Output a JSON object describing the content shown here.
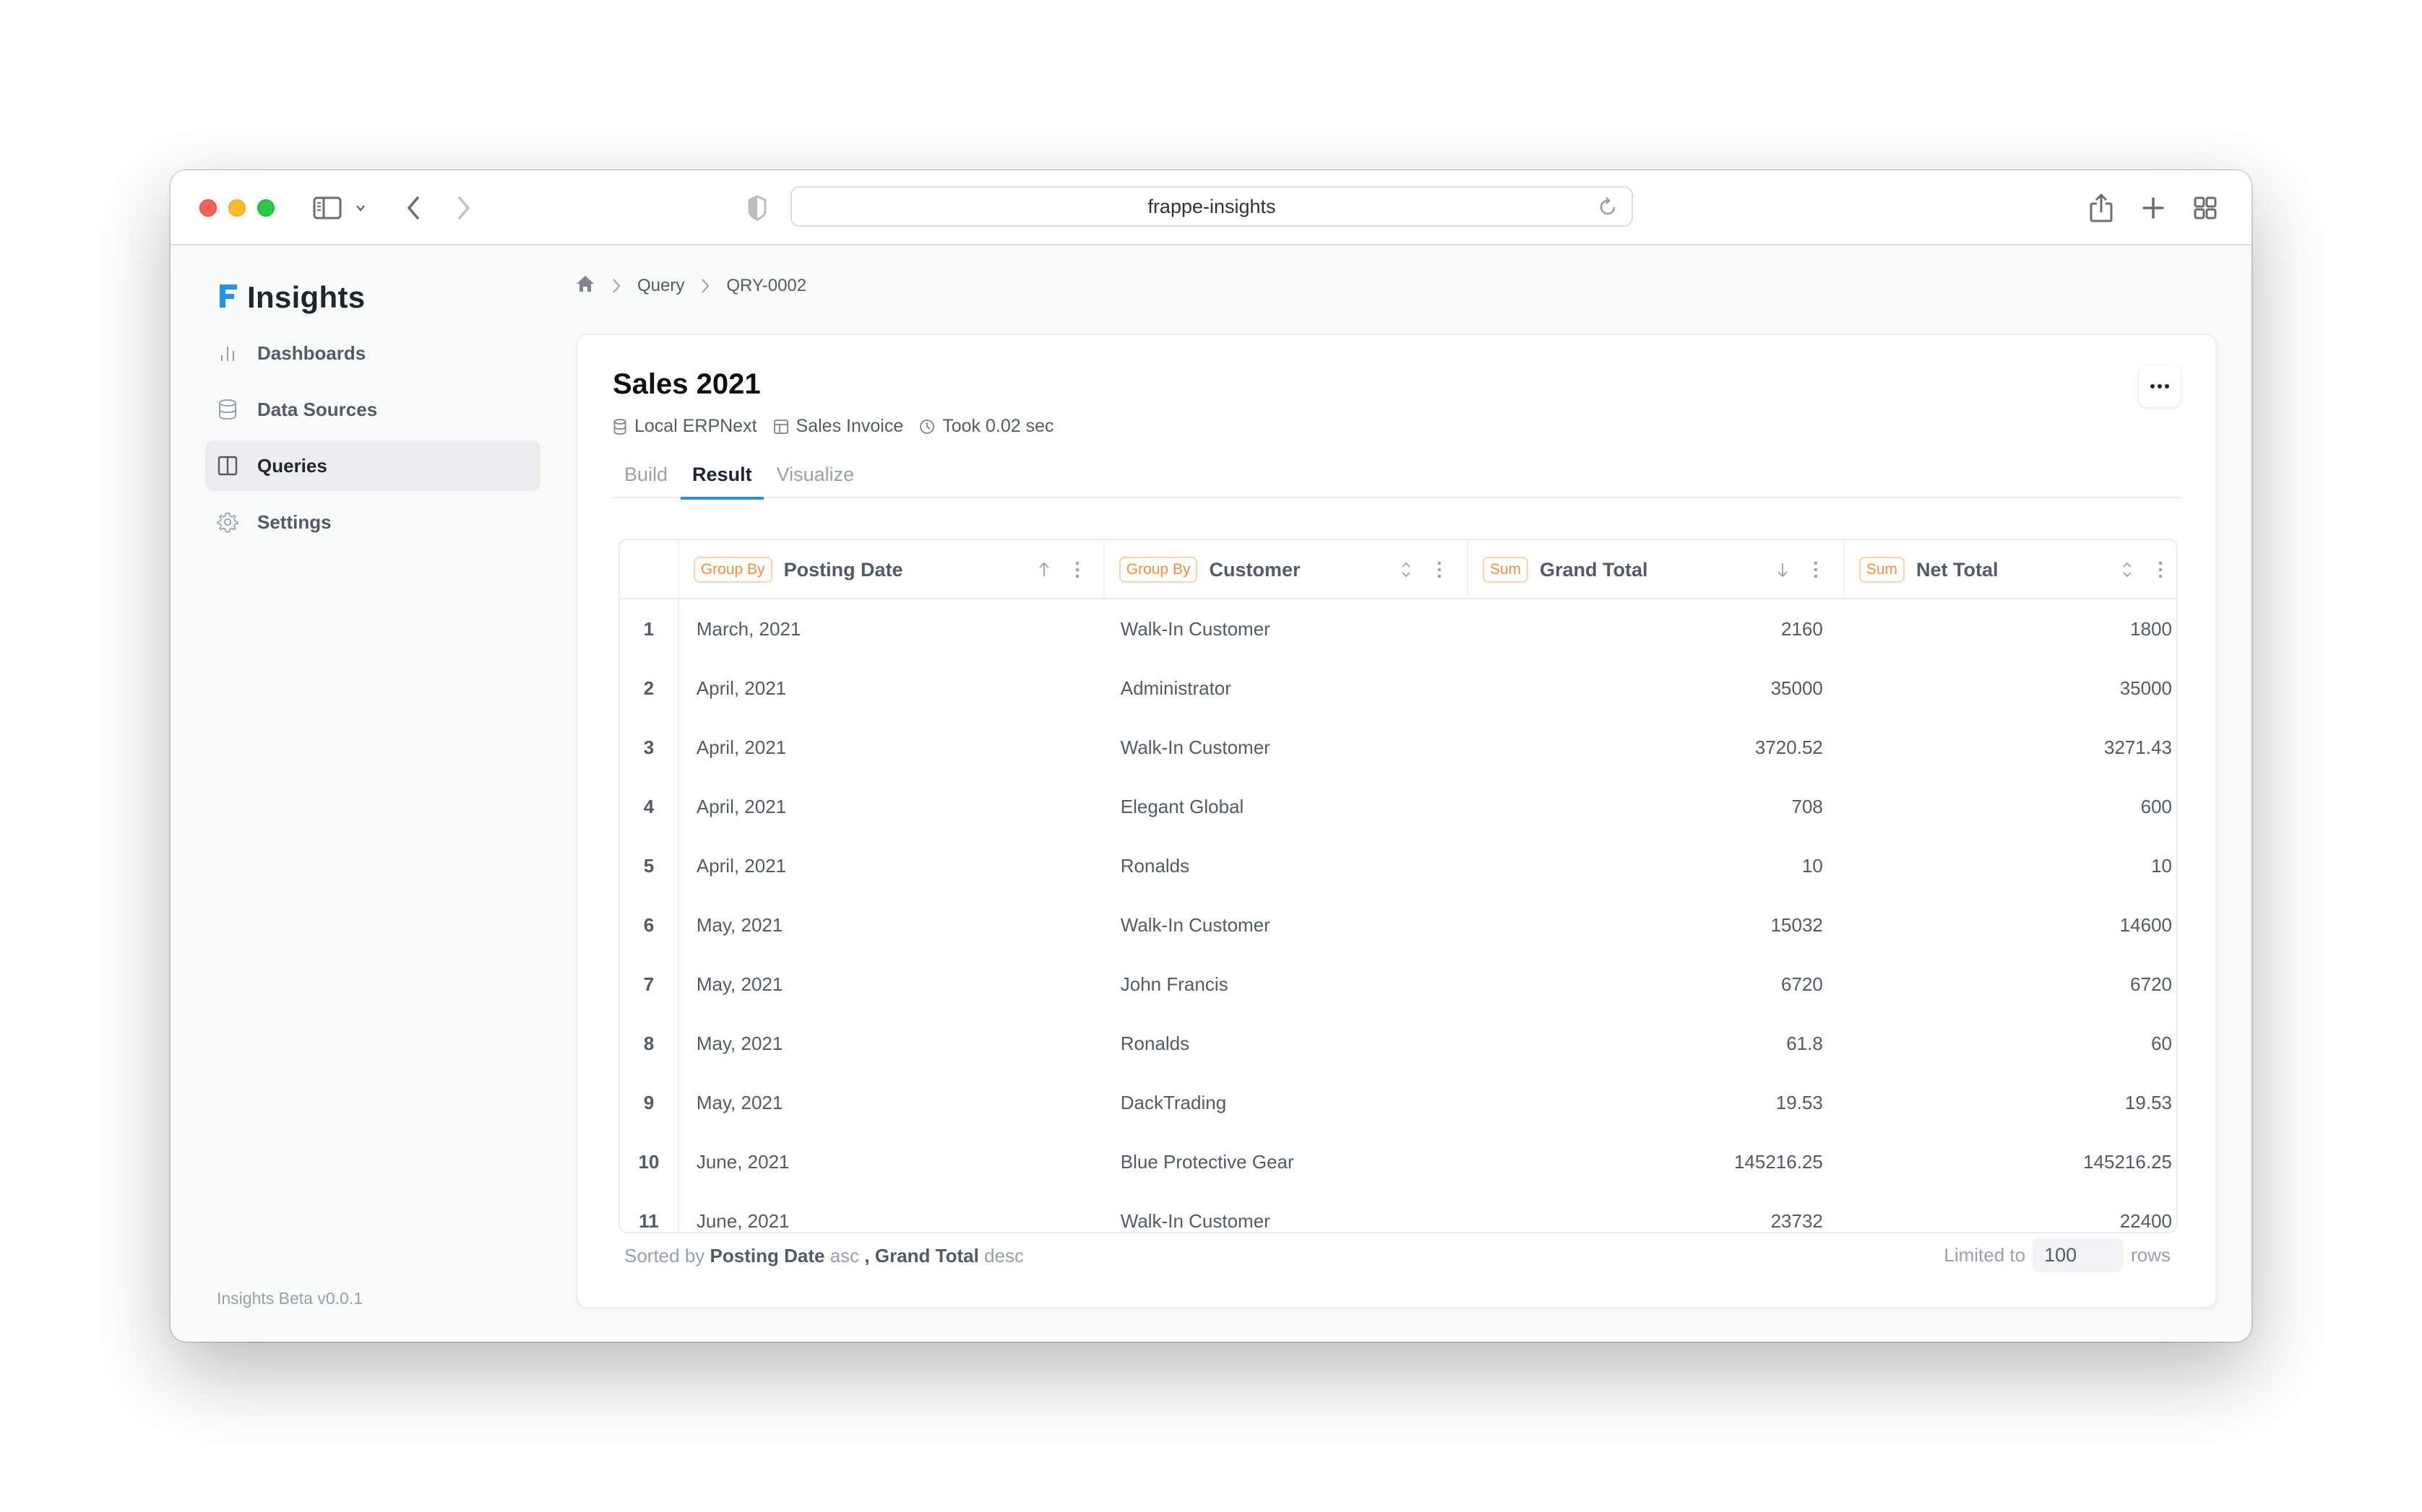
{
  "browser": {
    "url": "frappe-insights"
  },
  "sidebar": {
    "brand": "Insights",
    "brand_color": "#2490ef",
    "items": [
      {
        "label": "Dashboards",
        "icon": "bar-chart-icon",
        "active": false
      },
      {
        "label": "Data Sources",
        "icon": "database-icon",
        "active": false
      },
      {
        "label": "Queries",
        "icon": "columns-icon",
        "active": true
      },
      {
        "label": "Settings",
        "icon": "gear-icon",
        "active": false
      }
    ],
    "version": "Insights Beta v0.0.1"
  },
  "breadcrumb": {
    "items": [
      "Query",
      "QRY-0002"
    ]
  },
  "query": {
    "title": "Sales 2021",
    "data_source": "Local ERPNext",
    "table": "Sales Invoice",
    "execution_time": "Took 0.02 sec"
  },
  "tabs": [
    {
      "label": "Build",
      "active": false
    },
    {
      "label": "Result",
      "active": true
    },
    {
      "label": "Visualize",
      "active": false
    }
  ],
  "table": {
    "columns": [
      {
        "badge": "Group By",
        "name": "Posting Date",
        "sort": "asc"
      },
      {
        "badge": "Group By",
        "name": "Customer",
        "sort": "none"
      },
      {
        "badge": "Sum",
        "name": "Grand Total",
        "sort": "desc"
      },
      {
        "badge": "Sum",
        "name": "Net Total",
        "sort": "none"
      }
    ],
    "rows": [
      {
        "idx": "1",
        "posting_date": "March, 2021",
        "customer": "Walk-In Customer",
        "grand_total": "2160",
        "net_total": "1800"
      },
      {
        "idx": "2",
        "posting_date": "April, 2021",
        "customer": "Administrator",
        "grand_total": "35000",
        "net_total": "35000"
      },
      {
        "idx": "3",
        "posting_date": "April, 2021",
        "customer": "Walk-In Customer",
        "grand_total": "3720.52",
        "net_total": "3271.43"
      },
      {
        "idx": "4",
        "posting_date": "April, 2021",
        "customer": "Elegant Global",
        "grand_total": "708",
        "net_total": "600"
      },
      {
        "idx": "5",
        "posting_date": "April, 2021",
        "customer": "Ronalds",
        "grand_total": "10",
        "net_total": "10"
      },
      {
        "idx": "6",
        "posting_date": "May, 2021",
        "customer": "Walk-In Customer",
        "grand_total": "15032",
        "net_total": "14600"
      },
      {
        "idx": "7",
        "posting_date": "May, 2021",
        "customer": "John Francis",
        "grand_total": "6720",
        "net_total": "6720"
      },
      {
        "idx": "8",
        "posting_date": "May, 2021",
        "customer": "Ronalds",
        "grand_total": "61.8",
        "net_total": "60"
      },
      {
        "idx": "9",
        "posting_date": "May, 2021",
        "customer": "DackTrading",
        "grand_total": "19.53",
        "net_total": "19.53"
      },
      {
        "idx": "10",
        "posting_date": "June, 2021",
        "customer": "Blue Protective Gear",
        "grand_total": "145216.25",
        "net_total": "145216.25"
      },
      {
        "idx": "11",
        "posting_date": "June, 2021",
        "customer": "Walk-In Customer",
        "grand_total": "23732",
        "net_total": "22400"
      }
    ]
  },
  "footer": {
    "sorted_by_label": "Sorted by",
    "sort1_field": "Posting Date",
    "sort1_dir": "asc",
    "separator": ",",
    "sort2_field": "Grand Total",
    "sort2_dir": "desc",
    "limit_label": "Limited to",
    "limit_value": "100",
    "limit_suffix": "rows"
  },
  "colors": {
    "accent": "#2490ef",
    "badge_orange": "#fb8c3e",
    "text_muted": "#98a1ab",
    "text_body": "#525b66"
  }
}
